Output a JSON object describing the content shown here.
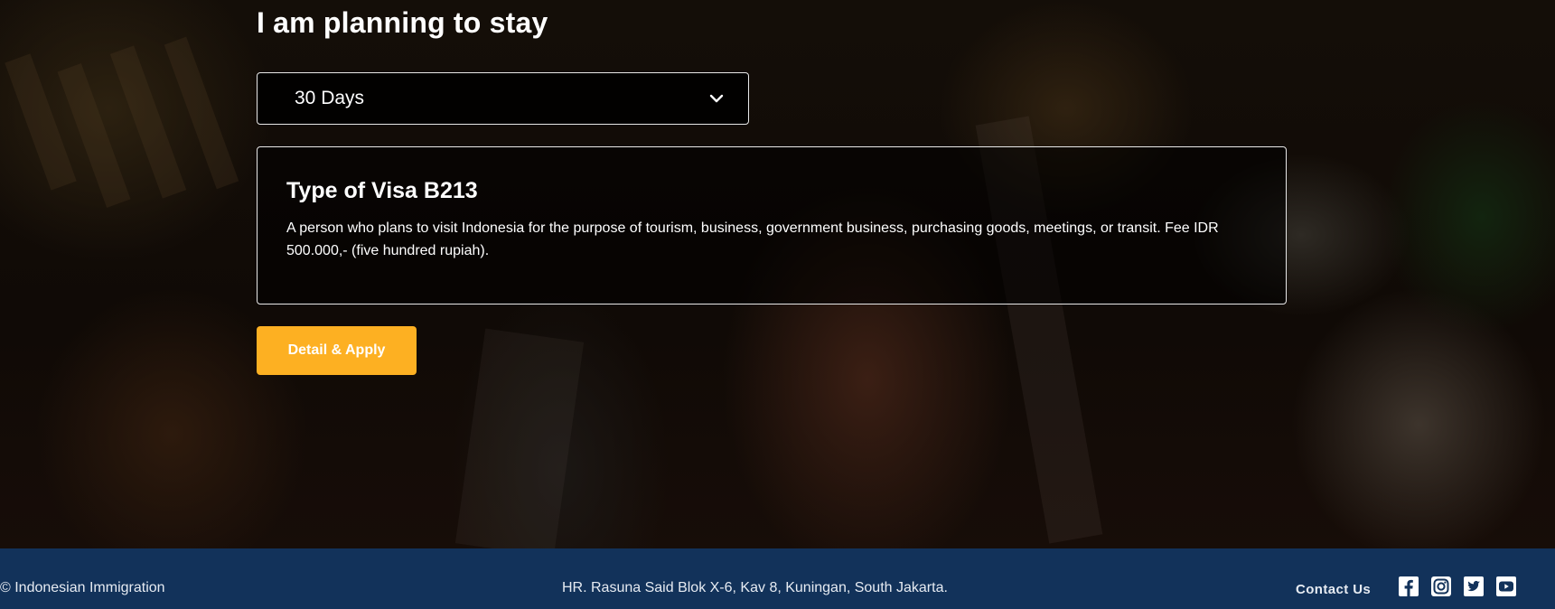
{
  "main": {
    "heading": "I am planning to stay",
    "duration_select": {
      "value": "30 Days",
      "icon": "chevron-down-icon"
    },
    "visa_card": {
      "title": "Type of Visa B213",
      "description": "A person who plans to visit Indonesia for the purpose of tourism, business, government business, purchasing goods, meetings, or transit. Fee IDR 500.000,- (five hundred rupiah)."
    },
    "apply_button": {
      "label": "Detail & Apply",
      "color": "#fdb022"
    }
  },
  "footer": {
    "background": "#12325a",
    "copyright": "© Indonesian Immigration",
    "address": "HR. Rasuna Said Blok X-6, Kav 8, Kuningan, South Jakarta.",
    "contact_label": "Contact Us",
    "social_icons": [
      "facebook-icon",
      "instagram-icon",
      "twitter-icon",
      "youtube-icon"
    ]
  }
}
